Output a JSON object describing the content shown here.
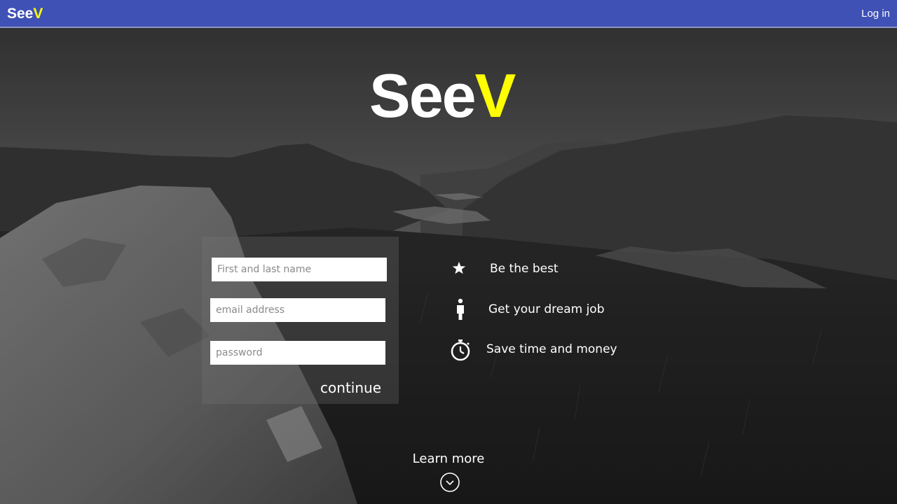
{
  "app": {
    "logo_main": "See",
    "logo_accent": "V",
    "brand_color": "#3f51b5",
    "accent_color": "#ffff00"
  },
  "nav": {
    "login_label": "Log in"
  },
  "hero": {
    "logo_main": "See",
    "logo_accent": "V"
  },
  "form": {
    "name_placeholder": "First and last name",
    "email_placeholder": "email address",
    "password_placeholder": "password",
    "continue_label": "continue"
  },
  "features": [
    {
      "icon": "star-icon",
      "text": "Be the best"
    },
    {
      "icon": "person-icon",
      "text": "Get your dream job"
    },
    {
      "icon": "stopwatch-icon",
      "text": "Save time and money"
    }
  ],
  "footer": {
    "learn_more_label": "Learn more",
    "learn_more_icon": "chevron-down-circle-icon"
  }
}
